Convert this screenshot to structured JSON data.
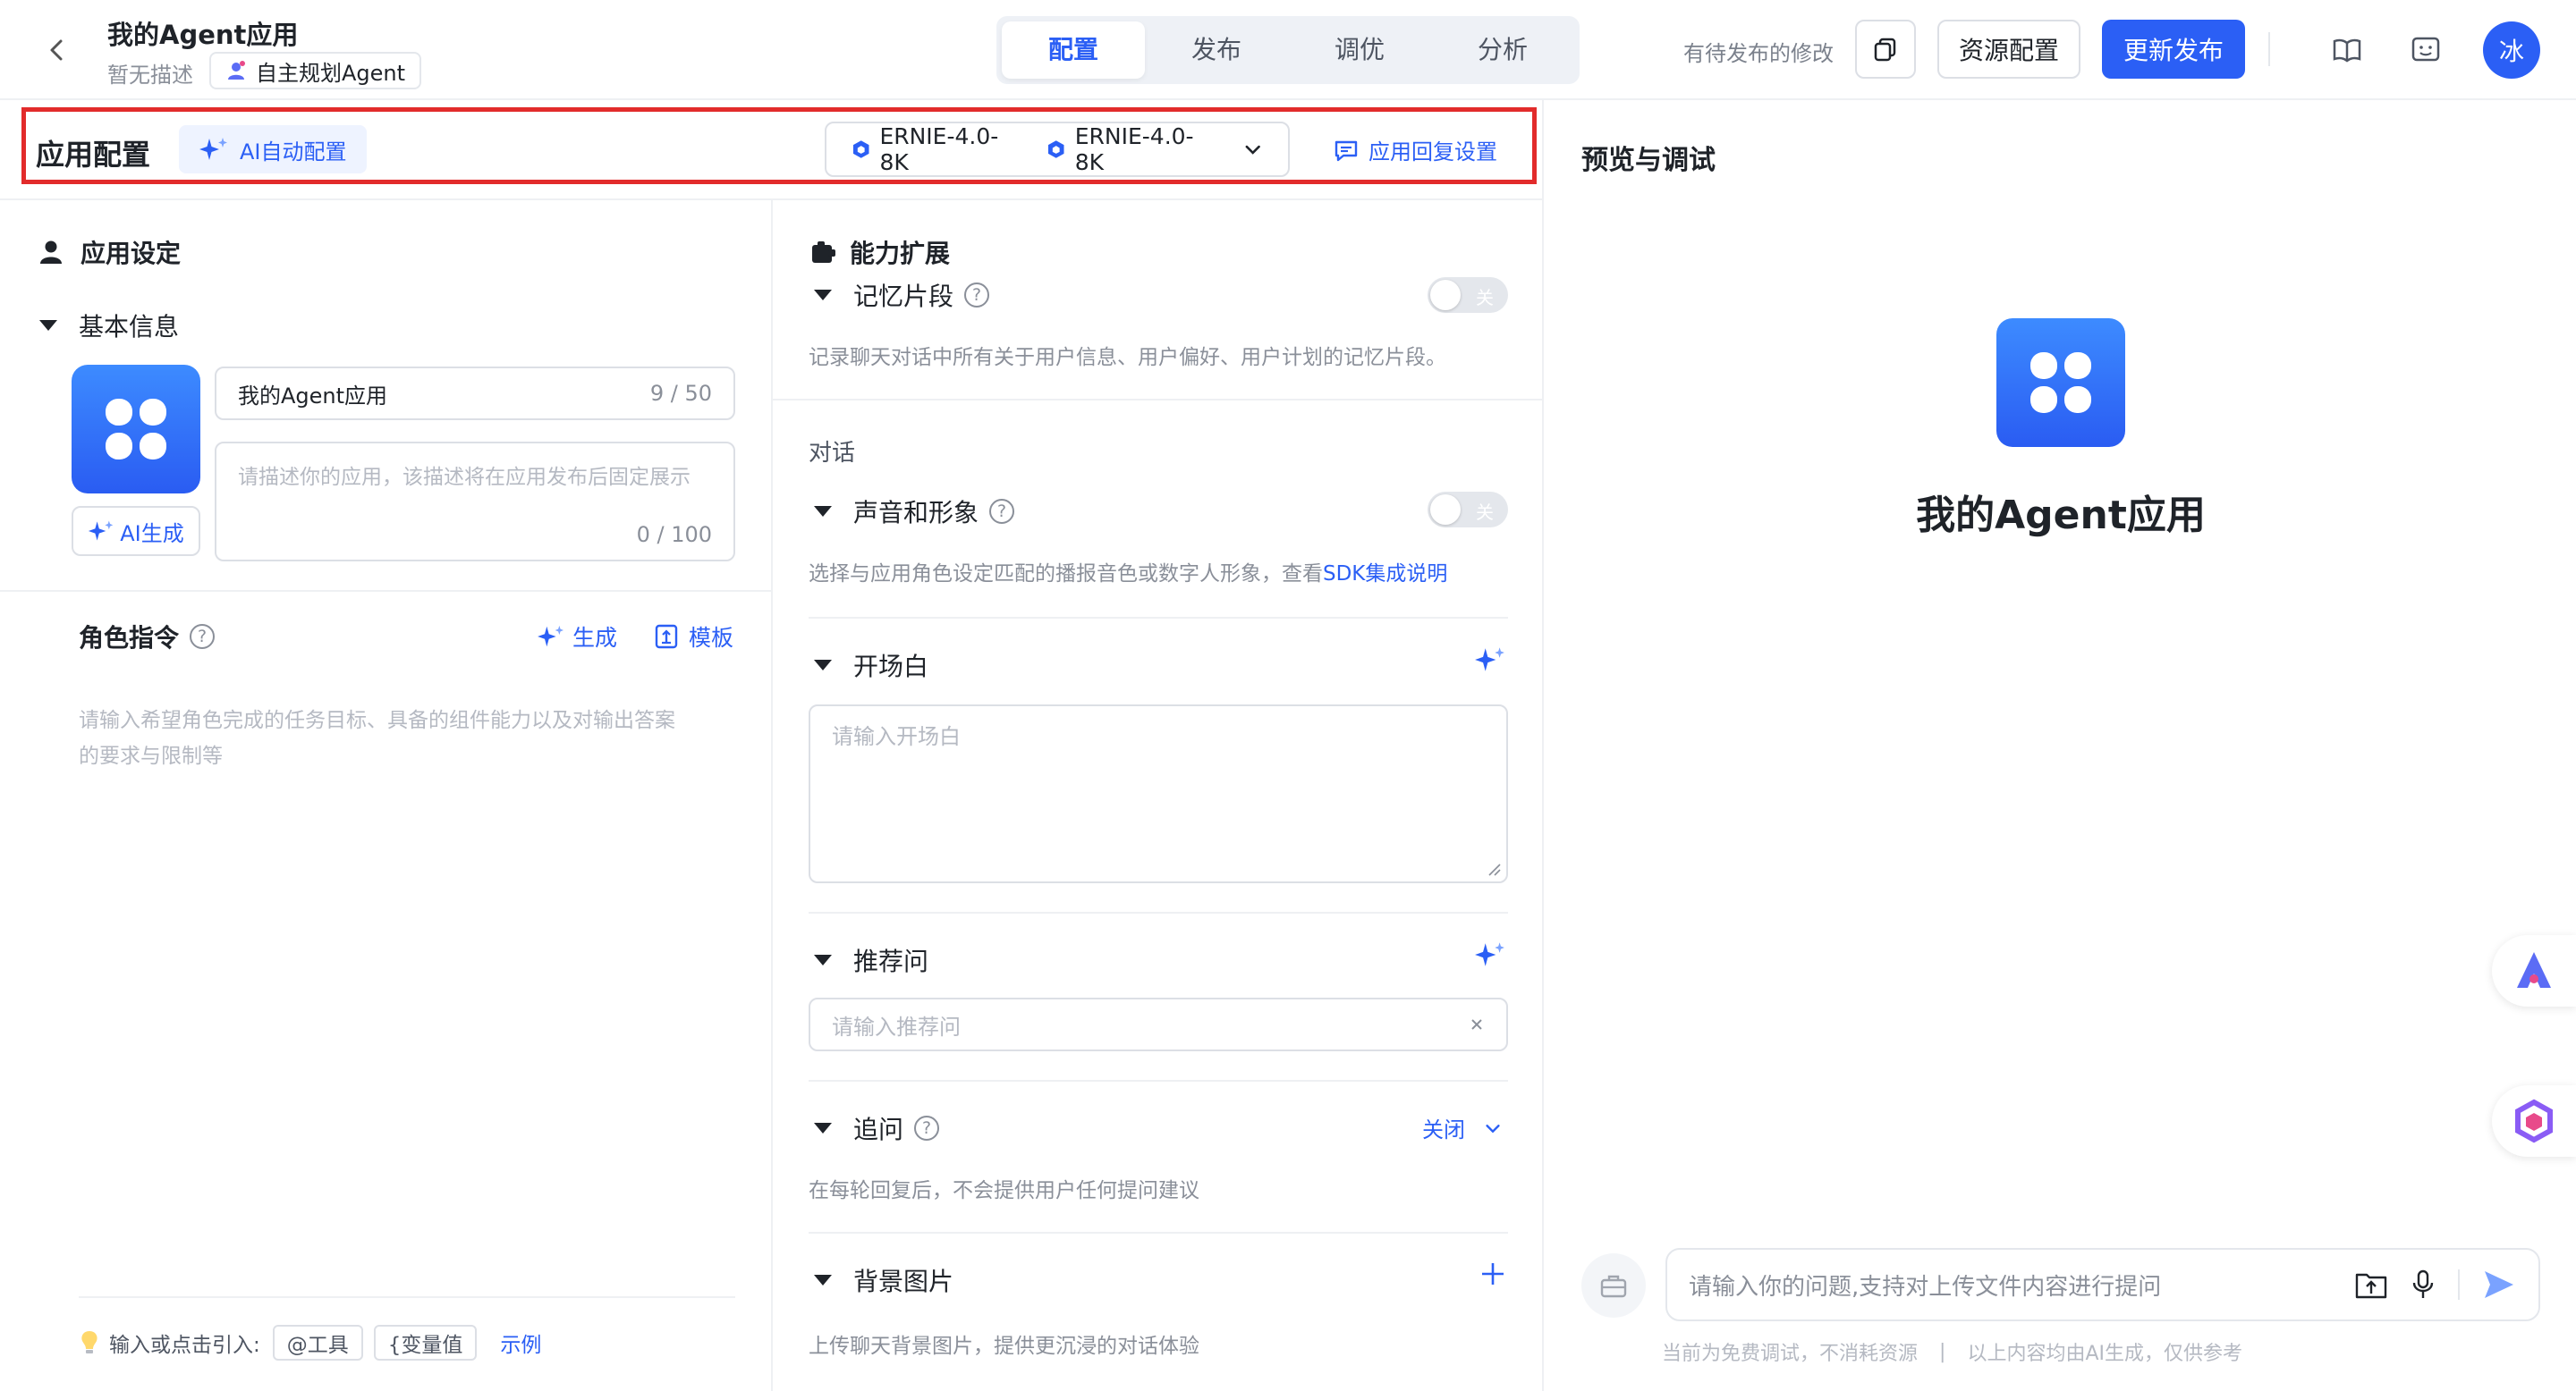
{
  "header": {
    "back_icon": "chevron-left-icon",
    "app_name": "我的Agent应用",
    "app_desc": "暂无描述",
    "app_type": "自主规划Agent",
    "tabs": [
      {
        "label": "配置",
        "active": true
      },
      {
        "label": "发布",
        "active": false
      },
      {
        "label": "调优",
        "active": false
      },
      {
        "label": "分析",
        "active": false
      }
    ],
    "pending_text": "有待发布的修改",
    "resource_btn": "资源配置",
    "publish_btn": "更新发布",
    "avatar_text": "冰",
    "accent": "#2b5ff5"
  },
  "config_bar": {
    "title": "应用配置",
    "ai_auto": "AI自动配置",
    "models": [
      "ERNIE-4.0-8K",
      "ERNIE-4.0-8K"
    ],
    "reply_settings": "应用回复设置"
  },
  "left": {
    "section_title": "应用设定",
    "basic_info": "基本信息",
    "name_value": "我的Agent应用",
    "name_count": "9 / 50",
    "desc_placeholder": "请描述你的应用，该描述将在应用发布后固定展示",
    "desc_count": "0 / 100",
    "ai_generate": "AI生成",
    "role_title": "角色指令",
    "role_generate": "生成",
    "role_template": "模板",
    "role_placeholder_line1": "请输入希望角色完成的任务目标、具备的组件能力以及对输出答案",
    "role_placeholder_line2": "的要求与限制等",
    "hint_prefix": "输入或点击引入:",
    "chip_tool": "@工具",
    "chip_var": "{变量值",
    "example": "示例"
  },
  "middle": {
    "section_title": "能力扩展",
    "memory": {
      "title": "记忆片段",
      "toggle": "关",
      "desc": "记录聊天对话中所有关于用户信息、用户偏好、用户计划的记忆片段。"
    },
    "dialog_label": "对话",
    "voice": {
      "title": "声音和形象",
      "toggle": "关",
      "desc": "选择与应用角色设定匹配的播报音色或数字人形象，查看",
      "link": "SDK集成说明"
    },
    "opening": {
      "title": "开场白",
      "placeholder": "请输入开场白"
    },
    "recommend": {
      "title": "推荐问",
      "placeholder": "请输入推荐问"
    },
    "followup": {
      "title": "追问",
      "status": "关闭",
      "desc": "在每轮回复后，不会提供用户任何提问建议"
    },
    "background": {
      "title": "背景图片",
      "desc": "上传聊天背景图片，提供更沉浸的对话体验"
    }
  },
  "preview": {
    "title": "预览与调试",
    "app_name": "我的Agent应用",
    "input_placeholder": "请输入你的问题,支持对上传文件内容进行提问",
    "footer_left": "当前为免费调试，不消耗资源",
    "footer_right": "以上内容均由AI生成，仅供参考"
  }
}
